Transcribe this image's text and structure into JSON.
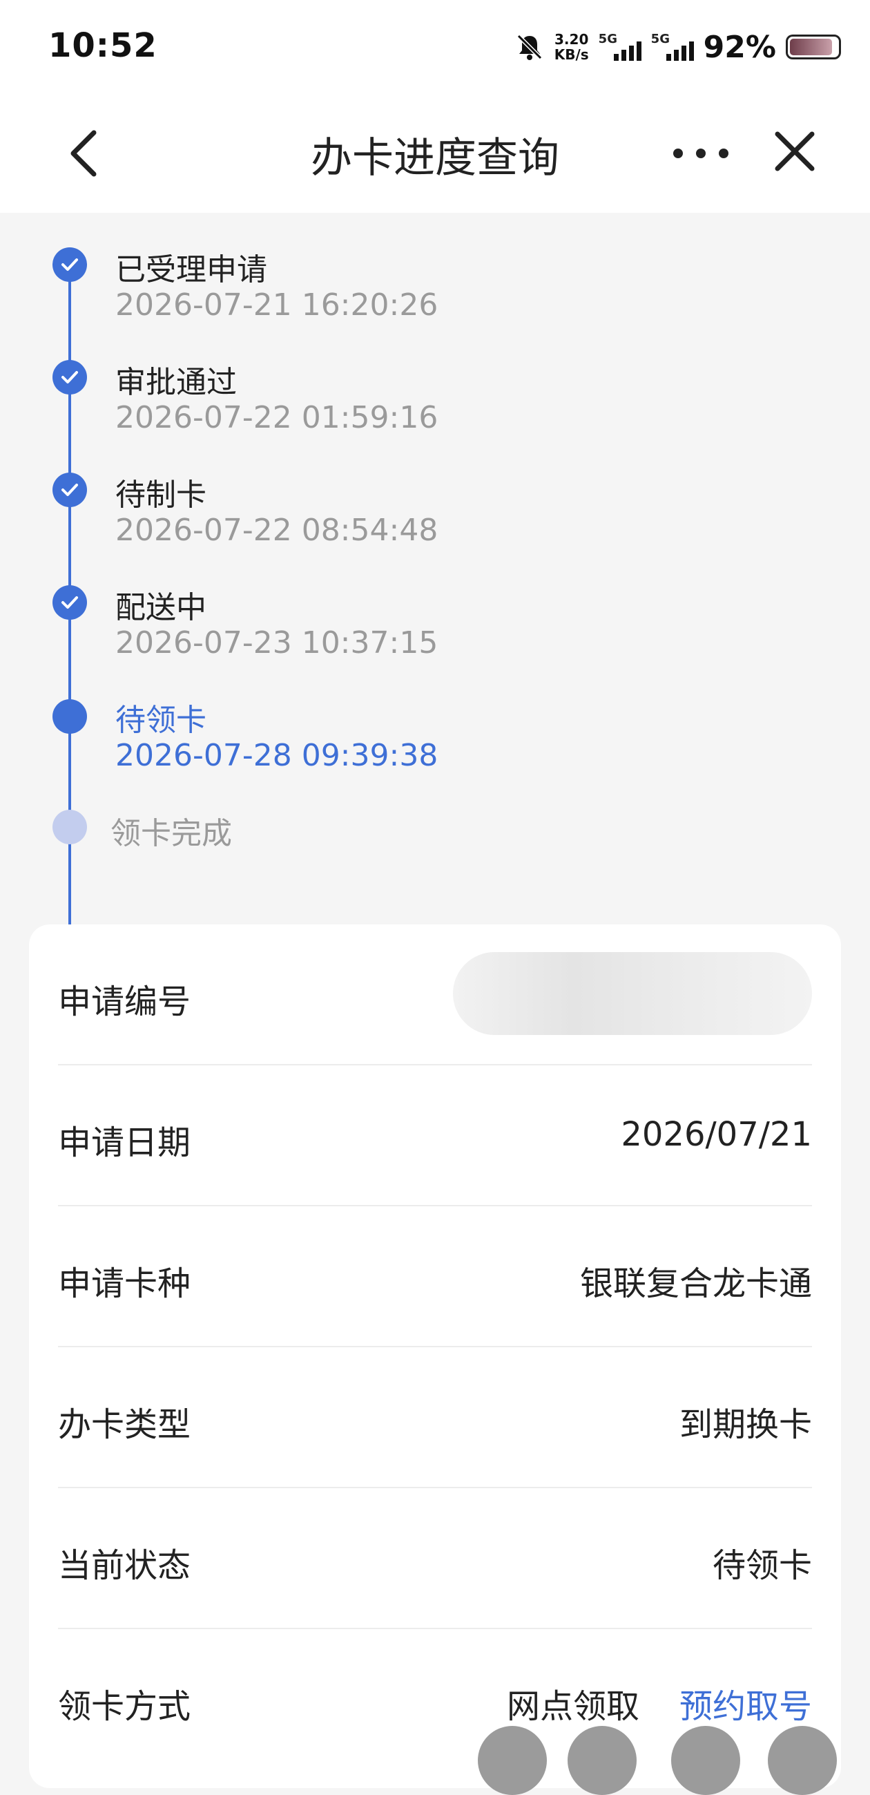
{
  "status_bar": {
    "time": "10:52",
    "net_speed_value": "3.20",
    "net_speed_unit": "KB/s",
    "signal_1": "5G",
    "signal_2": "5G",
    "battery": "92%"
  },
  "header": {
    "title": "办卡进度查询",
    "back_icon": "chevron-left-icon",
    "more_icon": "more-dots-icon",
    "close_icon": "close-icon"
  },
  "timeline": {
    "steps": [
      {
        "title": "已受理申请",
        "time": "2026-07-21 16:20:26",
        "state": "done"
      },
      {
        "title": "审批通过",
        "time": "2026-07-22 01:59:16",
        "state": "done"
      },
      {
        "title": "待制卡",
        "time": "2026-07-22 08:54:48",
        "state": "done"
      },
      {
        "title": "配送中",
        "time": "2026-07-23 10:37:15",
        "state": "done"
      },
      {
        "title": "待领卡",
        "time": "2026-07-28 09:39:38",
        "state": "current"
      },
      {
        "title": "领卡完成",
        "time": "",
        "state": "pending"
      }
    ]
  },
  "details": {
    "application_no_label": "申请编号",
    "application_date_label": "申请日期",
    "application_date": "2026/07/21",
    "card_type_label": "申请卡种",
    "card_type": "银联复合龙卡通",
    "apply_type_label": "办卡类型",
    "apply_type": "到期换卡",
    "status_label": "当前状态",
    "status": "待领卡",
    "pickup_label": "领卡方式",
    "pickup_method": "网点领取",
    "appointment_link": "预约取号"
  },
  "colors": {
    "accent": "#3e6fd6",
    "pending": "#c3cdee",
    "muted_text": "#9a9a9a",
    "background": "#f5f5f5"
  }
}
